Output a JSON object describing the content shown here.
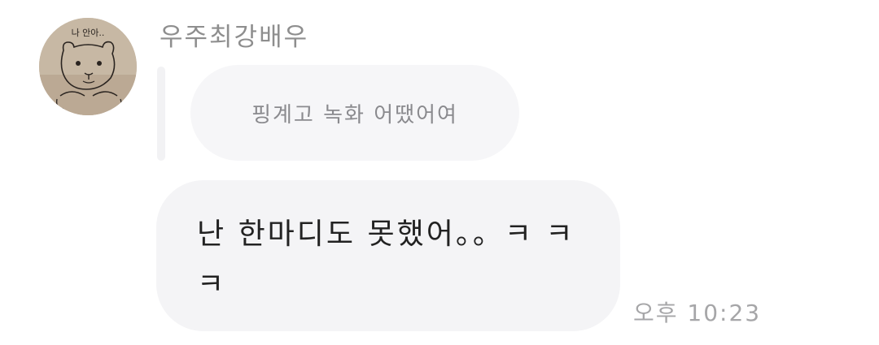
{
  "chat": {
    "sender": {
      "name": "우주최강배우",
      "avatar_caption": "나 안아.."
    },
    "reply": {
      "text": "핑계고 녹화 어땠어여"
    },
    "message": {
      "text": "난 한마디도 못했어。。ㅋ ㅋ ㅋ"
    },
    "timestamp": "오후 10:23"
  }
}
